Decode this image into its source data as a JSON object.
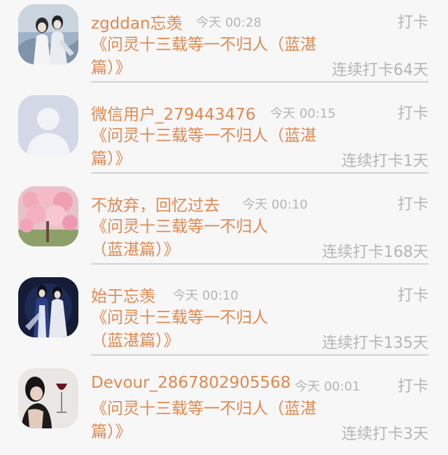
{
  "entries": [
    {
      "name": "zgddan忘羡",
      "time": "今天 00:28",
      "action": "打卡",
      "book": "《问灵十三载等一不归人（蓝湛篇）》",
      "streak": "连续打卡64天",
      "avatar": "avatar-photo-two-figures-white-robes"
    },
    {
      "name": "微信用户_279443476",
      "time": "今天 00:15",
      "action": "打卡",
      "book": "《问灵十三载等一不归人（蓝湛篇）》",
      "streak": "连续打卡1天",
      "avatar": "default-user-avatar"
    },
    {
      "name": "不放弃，回忆过去",
      "time": "今天 00:10",
      "action": "打卡",
      "book": "《问灵十三载等一不归人（蓝湛篇）》",
      "streak": "连续打卡168天",
      "avatar": "avatar-photo-pink-blossoms"
    },
    {
      "name": "始于忘羡",
      "time": "今天 00:10",
      "action": "打卡",
      "book": "《问灵十三载等一不归人（蓝湛篇）》",
      "streak": "连续打卡135天",
      "avatar": "avatar-photo-two-figures-dark"
    },
    {
      "name": "Devour_2867802905568",
      "time": "今天 00:01",
      "action": "打卡",
      "book": "《问灵十三载等一不归人（蓝湛篇）》",
      "streak": "连续打卡3天",
      "avatar": "avatar-photo-woman-wine-glass"
    }
  ],
  "colors": {
    "background": "#f8f7f8",
    "accent": "#e0894f",
    "muted": "#b5b5b5",
    "divider": "#d3d3d3"
  }
}
